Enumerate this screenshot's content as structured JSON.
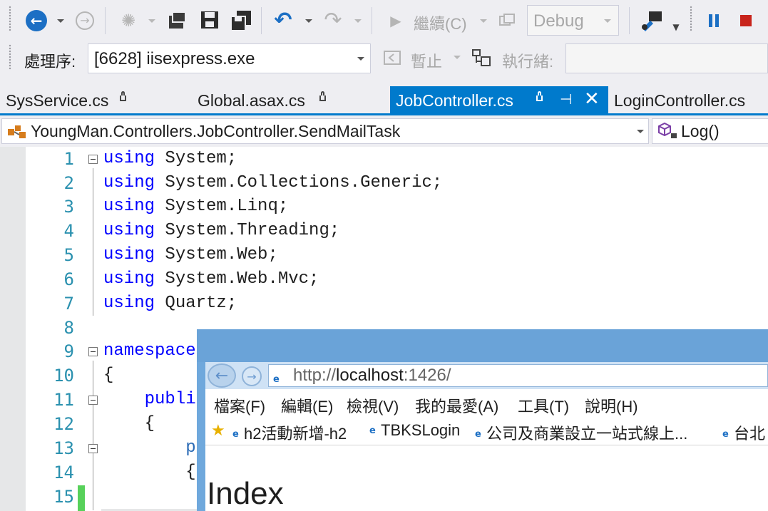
{
  "toolbar": {
    "continue_label": "繼續(C)",
    "config_value": "Debug",
    "process_label": "處理序:",
    "process_value": "[6628] iisexpress.exe",
    "suspend_label": "暫止",
    "thread_label": "執行緒:",
    "thread_value": ""
  },
  "tabs": [
    {
      "label": "SysService.cs",
      "locked": true,
      "active": false
    },
    {
      "label": "Global.asax.cs",
      "locked": true,
      "active": false
    },
    {
      "label": "JobController.cs",
      "locked": true,
      "active": true
    },
    {
      "label": "LoginController.cs",
      "locked": false,
      "active": false
    }
  ],
  "navbar": {
    "type_path": "YoungMan.Controllers.JobController.SendMailTask",
    "member": "Log()"
  },
  "editor": {
    "lines": [
      {
        "n": "1",
        "kw": "using",
        "rest": " System;"
      },
      {
        "n": "2",
        "kw": "using",
        "rest": " System.Collections.Generic;"
      },
      {
        "n": "3",
        "kw": "using",
        "rest": " System.Linq;"
      },
      {
        "n": "4",
        "kw": "using",
        "rest": " System.Threading;"
      },
      {
        "n": "5",
        "kw": "using",
        "rest": " System.Web;"
      },
      {
        "n": "6",
        "kw": "using",
        "rest": " System.Web.Mvc;"
      },
      {
        "n": "7",
        "kw": "using",
        "rest": " Quartz;"
      },
      {
        "n": "8",
        "kw": "",
        "rest": ""
      },
      {
        "n": "9",
        "kw": "namespace",
        "rest": ""
      },
      {
        "n": "10",
        "kw": "",
        "rest": "{"
      },
      {
        "n": "11",
        "kw": "    public",
        "rest": ""
      },
      {
        "n": "12",
        "kw": "",
        "rest": "    {"
      },
      {
        "n": "13",
        "kw": "",
        "rest": "        pu"
      },
      {
        "n": "14",
        "kw": "",
        "rest": "        {"
      },
      {
        "n": "15",
        "kw": "",
        "rest": ""
      }
    ]
  },
  "browser": {
    "url_scheme": "http://",
    "url_host": "localhost",
    "url_port_path": ":1426/",
    "menu": [
      "檔案(F)",
      "編輯(E)",
      "檢視(V)",
      "我的最愛(A)",
      "工具(T)",
      "說明(H)"
    ],
    "favorites": [
      "h2活動新增-h2",
      "TBKSLogin",
      "公司及商業設立一站式線上...",
      "台北"
    ],
    "page_heading": "Index"
  },
  "colors": {
    "accent": "#007acc",
    "keyword": "#0000ff",
    "line_number": "#2b91af",
    "stop": "#c8241c",
    "back_forward": "#1c6fc4"
  }
}
